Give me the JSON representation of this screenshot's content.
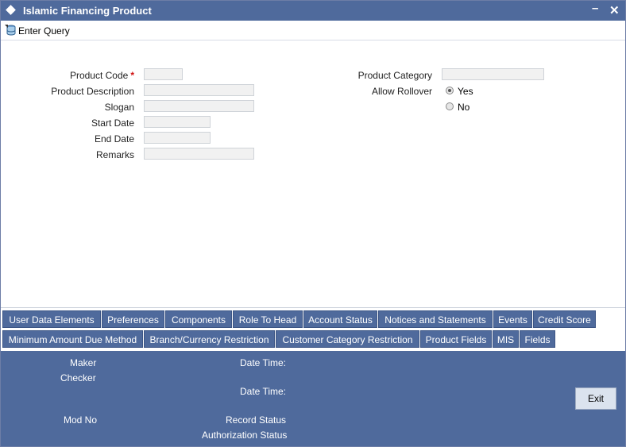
{
  "window": {
    "title": "Islamic Financing Product"
  },
  "toolbar": {
    "enter_query": "Enter Query"
  },
  "form": {
    "product_code": {
      "label": "Product Code",
      "required": "*",
      "value": ""
    },
    "product_description": {
      "label": "Product Description",
      "value": ""
    },
    "slogan": {
      "label": "Slogan",
      "value": ""
    },
    "start_date": {
      "label": "Start Date",
      "value": ""
    },
    "end_date": {
      "label": "End Date",
      "value": ""
    },
    "remarks": {
      "label": "Remarks",
      "value": ""
    },
    "product_category": {
      "label": "Product Category",
      "value": ""
    },
    "allow_rollover": {
      "label": "Allow Rollover",
      "options": [
        "Yes",
        "No"
      ],
      "selected": "Yes"
    }
  },
  "tabs_row1": [
    "User Data Elements",
    "Preferences",
    "Components",
    "Role To Head",
    "Account Status",
    "Notices and Statements",
    "Events",
    "Credit Score"
  ],
  "tabs_row2": [
    "Minimum Amount Due Method",
    "Branch/Currency Restriction",
    "Customer Category Restriction",
    "Product Fields",
    "MIS",
    "Fields"
  ],
  "footer": {
    "maker": "Maker",
    "checker": "Checker",
    "date_time_1": "Date Time:",
    "date_time_2": "Date Time:",
    "mod_no": "Mod No",
    "record_status": "Record Status",
    "authorization_status": "Authorization Status",
    "exit": "Exit"
  },
  "colors": {
    "title_bar": "#4f6a9c",
    "required": "#d01010",
    "footer": "#4f6a9c"
  }
}
